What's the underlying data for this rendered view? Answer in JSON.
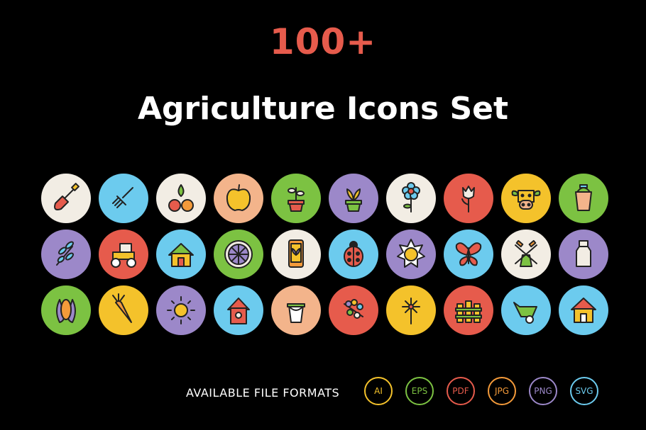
{
  "headline": {
    "count": "100+",
    "count_color": "#e65b4c",
    "title": "Agriculture Icons Set"
  },
  "icons": [
    {
      "name": "shovel-icon",
      "bg": "#f2ede4",
      "glyph": "shovel"
    },
    {
      "name": "rake-icon",
      "bg": "#6ccbee",
      "glyph": "rake"
    },
    {
      "name": "seeds-icon",
      "bg": "#f2ede4",
      "glyph": "seeds"
    },
    {
      "name": "apple-icon",
      "bg": "#f3b48b",
      "glyph": "apple"
    },
    {
      "name": "plant-pot-icon",
      "bg": "#7cc242",
      "glyph": "plantpot"
    },
    {
      "name": "sprout-pot-icon",
      "bg": "#9c88c9",
      "glyph": "sprout"
    },
    {
      "name": "flower-icon",
      "bg": "#f2ede4",
      "glyph": "flower"
    },
    {
      "name": "tulip-icon",
      "bg": "#e65b4c",
      "glyph": "tulip"
    },
    {
      "name": "cow-icon",
      "bg": "#f4c22b",
      "glyph": "cow"
    },
    {
      "name": "bucket-icon",
      "bg": "#7cc242",
      "glyph": "bucket"
    },
    {
      "name": "branch-icon",
      "bg": "#9c88c9",
      "glyph": "branch"
    },
    {
      "name": "tractor-icon",
      "bg": "#e65b4c",
      "glyph": "tractor"
    },
    {
      "name": "house-icon",
      "bg": "#6ccbee",
      "glyph": "house"
    },
    {
      "name": "citrus-slice-icon",
      "bg": "#7cc242",
      "glyph": "citrus"
    },
    {
      "name": "smartphone-plant-icon",
      "bg": "#f2ede4",
      "glyph": "phone"
    },
    {
      "name": "ladybug-icon",
      "bg": "#6ccbee",
      "glyph": "ladybug"
    },
    {
      "name": "sun-icon",
      "bg": "#9c88c9",
      "glyph": "sunstar"
    },
    {
      "name": "butterfly-icon",
      "bg": "#6ccbee",
      "glyph": "butterfly"
    },
    {
      "name": "windmill-icon",
      "bg": "#f2ede4",
      "glyph": "windmill"
    },
    {
      "name": "milk-can-icon",
      "bg": "#9c88c9",
      "glyph": "milkcan"
    },
    {
      "name": "corn-icon",
      "bg": "#7cc242",
      "glyph": "corn"
    },
    {
      "name": "carrot-icon",
      "bg": "#f4c22b",
      "glyph": "carrot"
    },
    {
      "name": "sunshine-icon",
      "bg": "#9c88c9",
      "glyph": "sunshine"
    },
    {
      "name": "birdhouse-icon",
      "bg": "#6ccbee",
      "glyph": "birdhouse"
    },
    {
      "name": "pail-icon",
      "bg": "#f3b48b",
      "glyph": "pail"
    },
    {
      "name": "berries-icon",
      "bg": "#e65b4c",
      "glyph": "berries"
    },
    {
      "name": "wind-vane-icon",
      "bg": "#f4c22b",
      "glyph": "vane"
    },
    {
      "name": "fence-icon",
      "bg": "#e65b4c",
      "glyph": "fence"
    },
    {
      "name": "wheelbarrow-icon",
      "bg": "#6ccbee",
      "glyph": "wheelbarrow"
    },
    {
      "name": "barn-icon",
      "bg": "#6ccbee",
      "glyph": "barn"
    }
  ],
  "formats": {
    "label": "AVAILABLE FILE FORMATS",
    "items": [
      {
        "label": "AI",
        "color": "#f4c22b"
      },
      {
        "label": "EPS",
        "color": "#7cc242"
      },
      {
        "label": "PDF",
        "color": "#e65b4c"
      },
      {
        "label": "JPG",
        "color": "#f39a3a"
      },
      {
        "label": "PNG",
        "color": "#9c88c9"
      },
      {
        "label": "SVG",
        "color": "#6ccbee"
      }
    ]
  }
}
